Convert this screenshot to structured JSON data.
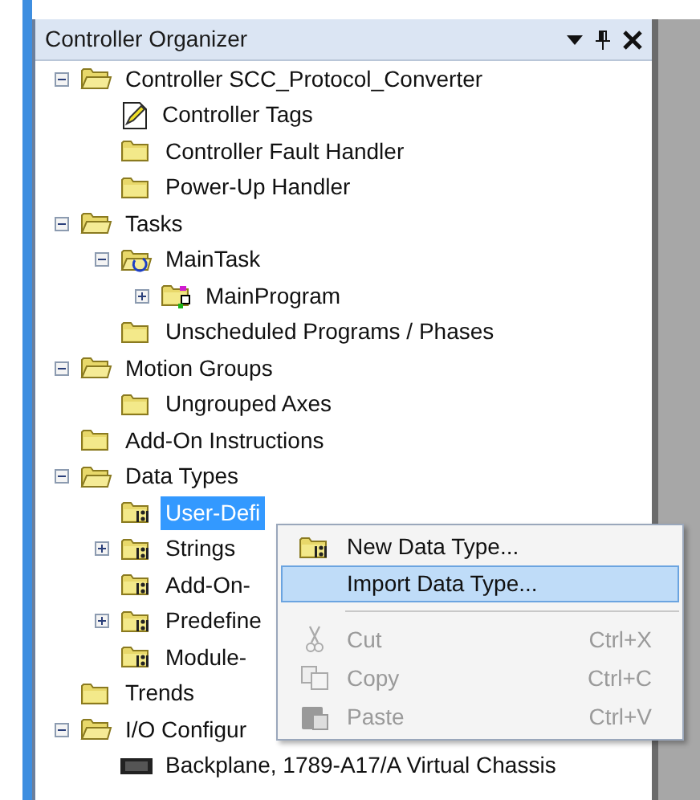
{
  "panel": {
    "title": "Controller Organizer"
  },
  "tree": [
    {
      "label": "Controller SCC_Protocol_Converter",
      "kind": "folder-open",
      "expanded": true,
      "selected": false,
      "children": [
        {
          "label": "Controller Tags",
          "kind": "tags",
          "selected": false
        },
        {
          "label": "Controller Fault Handler",
          "kind": "folder",
          "selected": false
        },
        {
          "label": "Power-Up Handler",
          "kind": "folder",
          "selected": false
        }
      ]
    },
    {
      "label": "Tasks",
      "kind": "folder-open",
      "expanded": true,
      "selected": false,
      "children": [
        {
          "label": "MainTask",
          "kind": "task",
          "expanded": true,
          "selected": false,
          "children": [
            {
              "label": "MainProgram",
              "kind": "program",
              "expanded": false,
              "selected": false
            }
          ]
        },
        {
          "label": "Unscheduled Programs / Phases",
          "kind": "folder",
          "selected": false
        }
      ]
    },
    {
      "label": "Motion Groups",
      "kind": "folder-open",
      "expanded": true,
      "selected": false,
      "children": [
        {
          "label": "Ungrouped Axes",
          "kind": "folder",
          "selected": false
        }
      ]
    },
    {
      "label": "Add-On Instructions",
      "kind": "folder",
      "selected": false
    },
    {
      "label": "Data Types",
      "kind": "folder-open",
      "expanded": true,
      "selected": false,
      "children": [
        {
          "label": "User-Defi",
          "kind": "datatype",
          "selected": true
        },
        {
          "label": "Strings",
          "kind": "datatype",
          "expanded": false,
          "selected": false
        },
        {
          "label": "Add-On-",
          "kind": "datatype",
          "selected": false
        },
        {
          "label": "Predefine",
          "kind": "datatype",
          "expanded": false,
          "selected": false
        },
        {
          "label": "Module-",
          "kind": "datatype",
          "selected": false
        }
      ]
    },
    {
      "label": "Trends",
      "kind": "folder",
      "selected": false
    },
    {
      "label": "I/O Configur",
      "kind": "folder-open",
      "expanded": true,
      "selected": false,
      "children": [
        {
          "label": "Backplane, 1789-A17/A Virtual Chassis",
          "kind": "chassis",
          "selected": false
        }
      ]
    }
  ],
  "context_menu": {
    "items": [
      {
        "kind": "new-type",
        "label": "New Data Type...",
        "disabled": false,
        "selected": false
      },
      {
        "kind": "import",
        "label": "Import Data Type...",
        "disabled": false,
        "selected": true
      },
      {
        "kind": "separator"
      },
      {
        "kind": "cut",
        "label": "Cut",
        "shortcut": "Ctrl+X",
        "disabled": true,
        "selected": false
      },
      {
        "kind": "copy",
        "label": "Copy",
        "shortcut": "Ctrl+C",
        "disabled": true,
        "selected": false
      },
      {
        "kind": "paste",
        "label": "Paste",
        "shortcut": "Ctrl+V",
        "disabled": true,
        "selected": false
      }
    ]
  }
}
